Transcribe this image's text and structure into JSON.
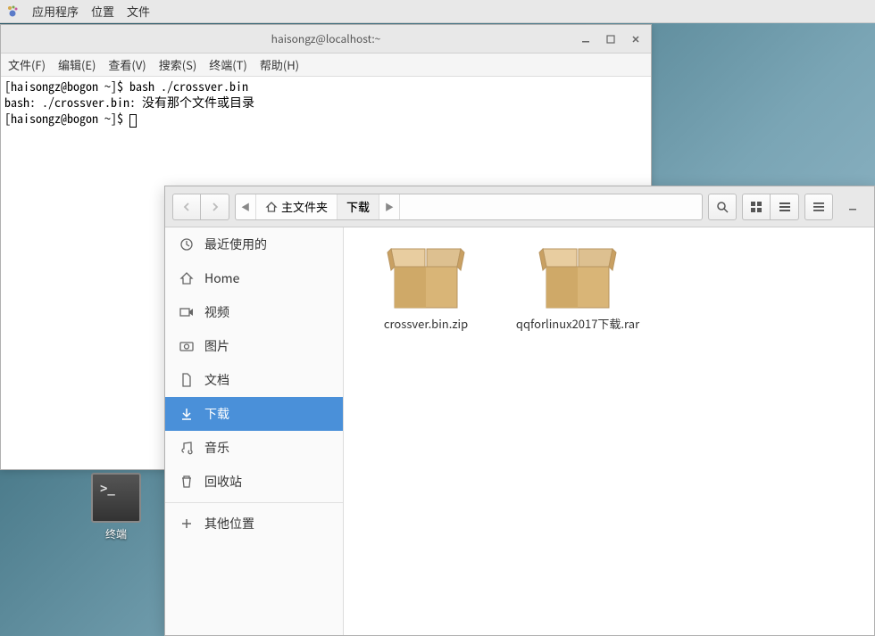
{
  "panel": {
    "apps": "应用程序",
    "places": "位置",
    "file": "文件"
  },
  "terminal": {
    "title": "haisongz@localhost:~",
    "menu": {
      "file": "文件(F)",
      "edit": "编辑(E)",
      "view": "查看(V)",
      "search": "搜索(S)",
      "terminal": "终端(T)",
      "help": "帮助(H)"
    },
    "lines": [
      "[haisongz@bogon ~]$ bash ./crossver.bin",
      "bash: ./crossver.bin: 没有那个文件或目录",
      "[haisongz@bogon ~]$ "
    ]
  },
  "desktop": {
    "terminal_label": "终端",
    "prompt": ">_"
  },
  "fm": {
    "path": {
      "home": "主文件夹",
      "current": "下载"
    },
    "sidebar": [
      {
        "icon": "clock",
        "label": "最近使用的"
      },
      {
        "icon": "home",
        "label": "Home"
      },
      {
        "icon": "video",
        "label": "视频"
      },
      {
        "icon": "camera",
        "label": "图片"
      },
      {
        "icon": "doc",
        "label": "文档"
      },
      {
        "icon": "download",
        "label": "下载",
        "selected": true
      },
      {
        "icon": "music",
        "label": "音乐"
      },
      {
        "icon": "trash",
        "label": "回收站"
      }
    ],
    "other_locations": "其他位置",
    "files": [
      {
        "name": "crossver.bin.zip"
      },
      {
        "name": "qqforlinux2017下载.rar"
      }
    ]
  }
}
